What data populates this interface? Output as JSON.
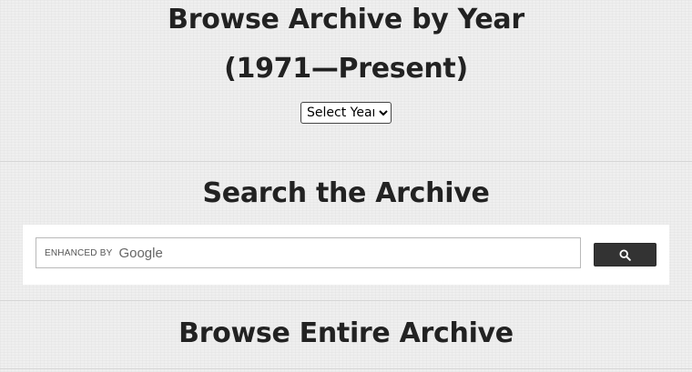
{
  "browse_by_year": {
    "title": "Browse Archive by Year",
    "subtitle": "(1971—Present)",
    "select": {
      "selected": "Select Year"
    }
  },
  "search": {
    "title": "Search the Archive",
    "input": {
      "enhanced_label": "ENHANCED BY",
      "brand_label": "Google",
      "value": ""
    },
    "button_icon": "search-icon",
    "button_color": "#333333"
  },
  "browse_entire": {
    "title": "Browse Entire Archive"
  }
}
